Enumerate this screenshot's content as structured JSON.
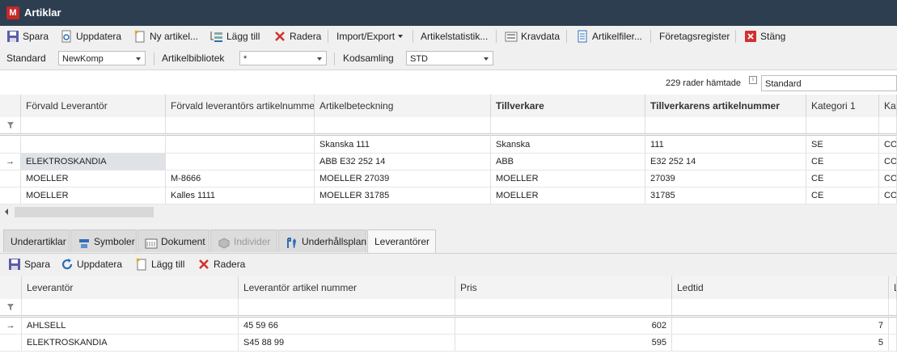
{
  "window": {
    "title": "Artiklar",
    "logo_text": "M"
  },
  "toolbar": {
    "save": "Spara",
    "refresh": "Uppdatera",
    "new_article": "Ny artikel...",
    "add": "Lägg till",
    "delete": "Radera",
    "import_export": "Import/Export",
    "article_stats": "Artikelstatistik...",
    "requirements": "Kravdata",
    "article_files": "Artikelfiler...",
    "company_register": "Företagsregister",
    "close": "Stäng"
  },
  "filters": {
    "standard_label": "Standard",
    "standard_value": "NewKomp",
    "library_label": "Artikelbibliotek",
    "library_value": "*",
    "code_label": "Kodsamling",
    "code_value": "STD"
  },
  "grid_info": {
    "rows_fetched": "229 rader hämtade",
    "layout_value": "Standard"
  },
  "main_grid": {
    "columns": [
      "Förvald Leverantör",
      "Förvald leverantörs artikelnummer",
      "Artikelbeteckning",
      "Tillverkare",
      "Tillverkarens artikelnummer",
      "Kategori 1",
      "Kate"
    ],
    "rows": [
      [
        "",
        "",
        "Skanska 111",
        "Skanska",
        "111",
        "SE",
        "CON"
      ],
      [
        "ELEKTROSKANDIA",
        "",
        "ABB E32 252 14",
        "ABB",
        "E32 252 14",
        "CE",
        "CON"
      ],
      [
        "MOELLER",
        "M-8666",
        "MOELLER 27039",
        "MOELLER",
        "27039",
        "CE",
        "CON"
      ],
      [
        "MOELLER",
        "Kalles 1111",
        "MOELLER 31785",
        "MOELLER",
        "31785",
        "CE",
        "CON"
      ]
    ],
    "current_row_indicator": "→"
  },
  "tabs": {
    "items": [
      "Underartiklar",
      "Symboler",
      "Dokument",
      "Individer",
      "Underhållsplan",
      "Leverantörer"
    ]
  },
  "sub_toolbar": {
    "save": "Spara",
    "refresh": "Uppdatera",
    "add": "Lägg till",
    "delete": "Radera"
  },
  "supplier_grid": {
    "columns": [
      "Leverantör",
      "Leverantör artikel nummer",
      "Pris",
      "Ledtid",
      "L"
    ],
    "rows": [
      [
        "AHLSELL",
        "45 59 66",
        "602",
        "7"
      ],
      [
        "ELEKTROSKANDIA",
        "S45 88 99",
        "595",
        "5"
      ]
    ],
    "current_row_indicator": "→"
  },
  "colors": {
    "titlebar": "#2d3e50",
    "accent_red": "#d32f2f",
    "accent_blue": "#2e6db4"
  }
}
